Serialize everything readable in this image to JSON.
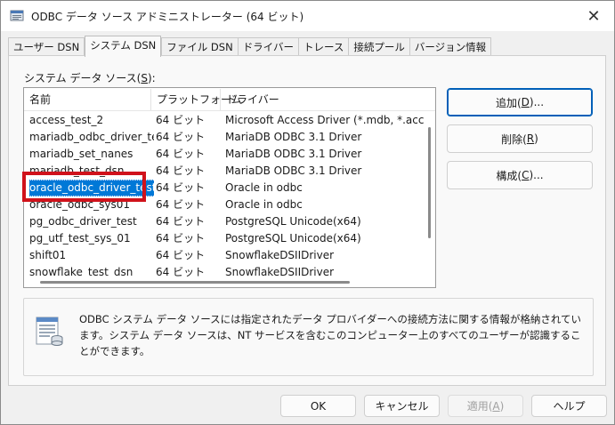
{
  "window": {
    "title": "ODBC データ ソース アドミニストレーター (64 ビット)",
    "close_glyph": "✕"
  },
  "tabs": [
    {
      "label": "ユーザー DSN",
      "active": false
    },
    {
      "label": "システム DSN",
      "active": true
    },
    {
      "label": "ファイル DSN",
      "active": false
    },
    {
      "label": "ドライバー",
      "active": false
    },
    {
      "label": "トレース",
      "active": false
    },
    {
      "label": "接続プール",
      "active": false
    },
    {
      "label": "バージョン情報",
      "active": false
    }
  ],
  "list": {
    "label_prefix": "システム データ ソース(",
    "label_mnemonic": "S",
    "label_suffix": "):",
    "columns": [
      "名前",
      "プラットフォーム",
      "ドライバー"
    ],
    "rows": [
      {
        "name": "access_test_2",
        "platform": "64 ビット",
        "driver": "Microsoft Access Driver (*.mdb, *.accdb)"
      },
      {
        "name": "mariadb_odbc_driver_test",
        "platform": "64 ビット",
        "driver": "MariaDB ODBC 3.1 Driver"
      },
      {
        "name": "mariadb_set_nanes",
        "platform": "64 ビット",
        "driver": "MariaDB ODBC 3.1 Driver"
      },
      {
        "name": "mariadb_test_dsn",
        "platform": "64 ビット",
        "driver": "MariaDB ODBC 3.1 Driver"
      },
      {
        "name": "oracle_odbc_driver_test",
        "platform": "64 ビット",
        "driver": "Oracle in odbc",
        "selected": true
      },
      {
        "name": "oracle_odbc_sys01",
        "platform": "64 ビット",
        "driver": "Oracle in odbc"
      },
      {
        "name": "pg_odbc_driver_test",
        "platform": "64 ビット",
        "driver": "PostgreSQL Unicode(x64)"
      },
      {
        "name": "pg_utf_test_sys_01",
        "platform": "64 ビット",
        "driver": "PostgreSQL Unicode(x64)"
      },
      {
        "name": "shift01",
        "platform": "64 ビット",
        "driver": "SnowflakeDSIIDriver"
      },
      {
        "name": "snowflake_test_dsn",
        "platform": "64 ビット",
        "driver": "SnowflakeDSIIDriver"
      }
    ]
  },
  "buttons": {
    "add": {
      "prefix": "追加(",
      "mnemonic": "D",
      "suffix": ")..."
    },
    "remove": {
      "prefix": "削除(",
      "mnemonic": "R",
      "suffix": ")"
    },
    "configure": {
      "prefix": "構成(",
      "mnemonic": "C",
      "suffix": ")..."
    }
  },
  "info": {
    "text": "ODBC システム データ ソースには指定されたデータ プロバイダーへの接続方法に関する情報が格納されています。システム データ ソースは、NT サービスを含むこのコンピューター上のすべてのユーザーが認識することができます。"
  },
  "footer": {
    "ok": "OK",
    "cancel": "キャンセル",
    "apply_prefix": "適用(",
    "apply_mnemonic": "A",
    "apply_suffix": ")",
    "help": "ヘルプ"
  },
  "colors": {
    "selection": "#0078d7",
    "highlight_frame": "#d0121b",
    "default_button_border": "#005fb8"
  }
}
